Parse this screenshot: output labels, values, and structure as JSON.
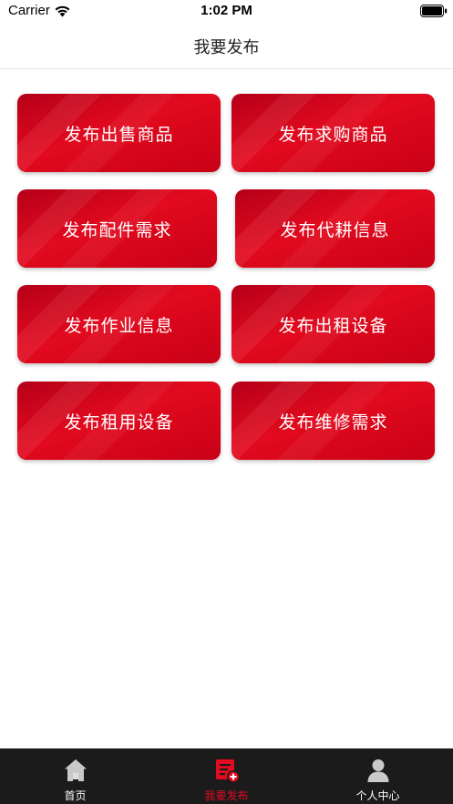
{
  "status_bar": {
    "carrier": "Carrier",
    "time": "1:02 PM"
  },
  "header": {
    "title": "我要发布"
  },
  "actions": [
    {
      "label": "发布出售商品"
    },
    {
      "label": "发布求购商品"
    },
    {
      "label": "发布配件需求"
    },
    {
      "label": "发布代耕信息"
    },
    {
      "label": "发布作业信息"
    },
    {
      "label": "发布出租设备"
    },
    {
      "label": "发布租用设备"
    },
    {
      "label": "发布维修需求"
    }
  ],
  "tabs": [
    {
      "label": "首页",
      "icon": "home-icon"
    },
    {
      "label": "我要发布",
      "icon": "publish-icon",
      "active": true
    },
    {
      "label": "个人中心",
      "icon": "person-icon"
    }
  ],
  "colors": {
    "accent": "#e30b1f",
    "button_dark": "#b50019",
    "tab_bar_bg": "#1b1b1b"
  }
}
